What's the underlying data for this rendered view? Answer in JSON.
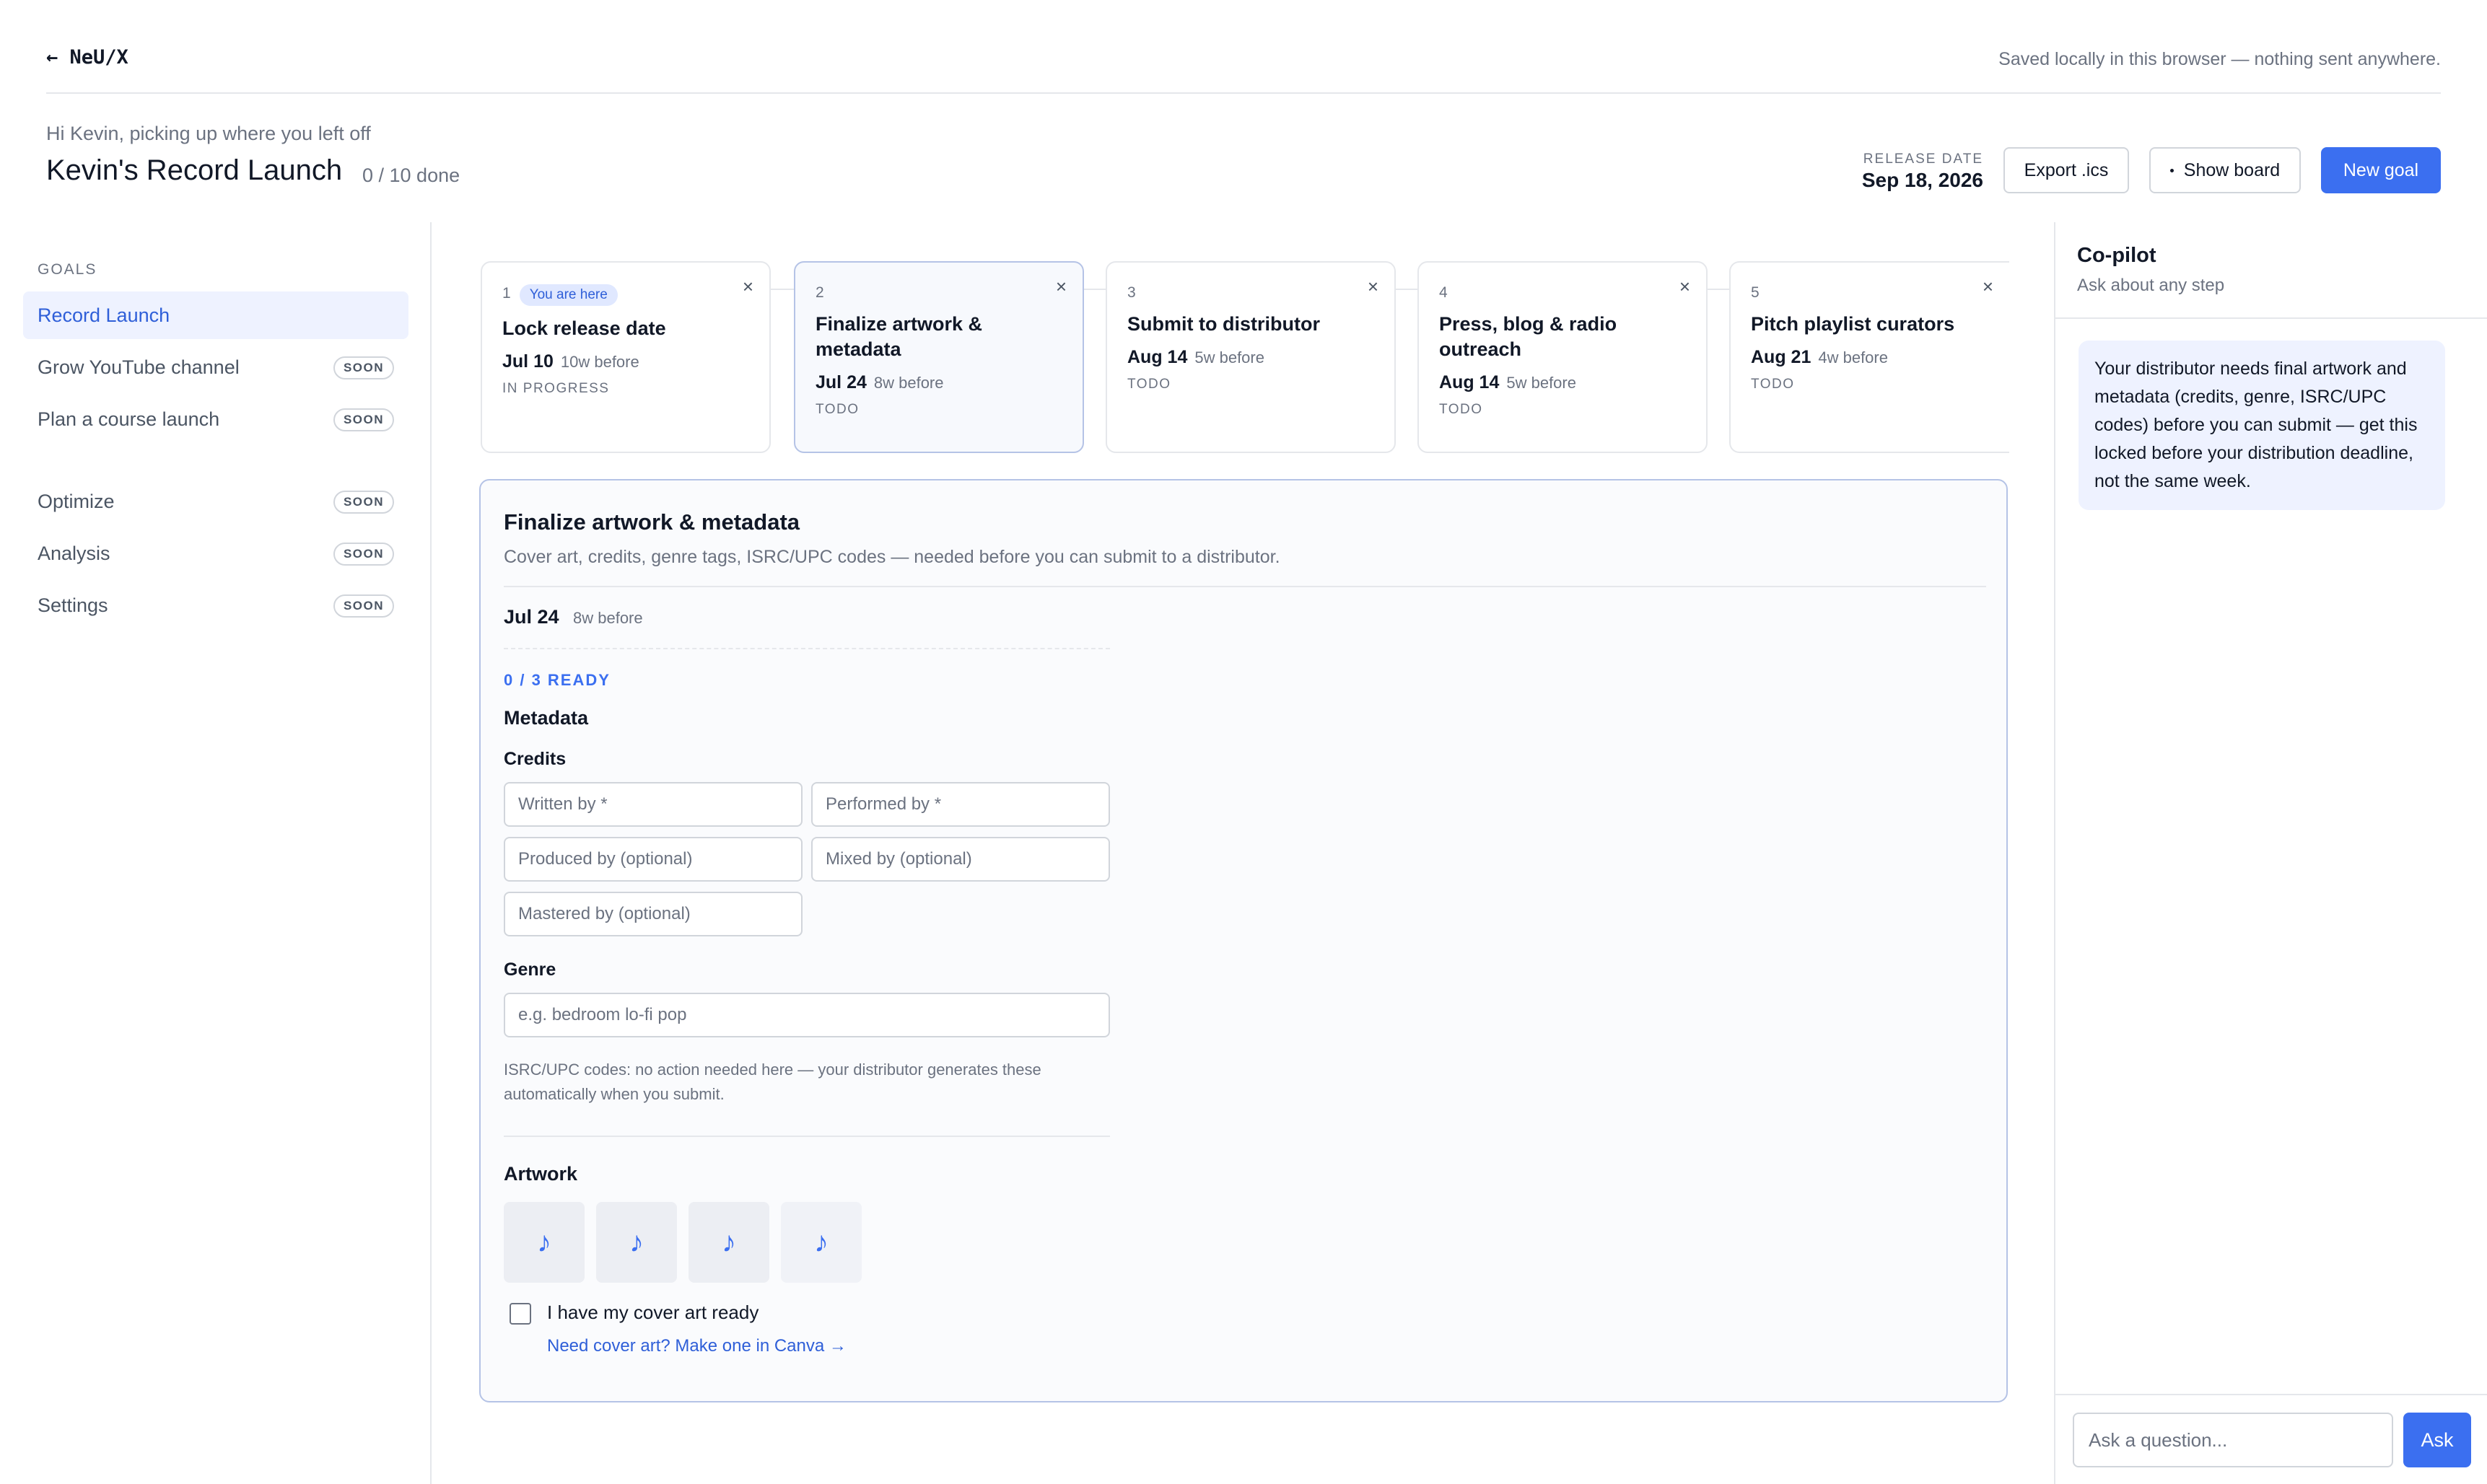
{
  "topbar": {
    "brand": "← NeU/X",
    "saved_note": "Saved locally in this browser — nothing sent anywhere."
  },
  "header": {
    "greeting": "Hi Kevin, picking up where you left off",
    "title": "Kevin's Record Launch",
    "progress": "0 / 10 done",
    "release_label": "RELEASE DATE",
    "release_date": "Sep 18, 2026",
    "export_label": "Export .ics",
    "board_label": "Show board",
    "new_goal_label": "New goal"
  },
  "sidebar": {
    "heading": "GOALS",
    "items": [
      {
        "label": "Record Launch",
        "badge": ""
      },
      {
        "label": "Grow YouTube channel",
        "badge": "SOON"
      },
      {
        "label": "Plan a course launch",
        "badge": "SOON"
      },
      {
        "label": "Optimize",
        "badge": "SOON"
      },
      {
        "label": "Analysis",
        "badge": "SOON"
      },
      {
        "label": "Settings",
        "badge": "SOON"
      }
    ]
  },
  "steps": [
    {
      "num": "1",
      "badge": "You are here",
      "title": "Lock release date",
      "date": "Jul 10",
      "rel": "10w before",
      "status": "IN PROGRESS",
      "close": "×"
    },
    {
      "num": "2",
      "badge": "",
      "title": "Finalize artwork & metadata",
      "date": "Jul 24",
      "rel": "8w before",
      "status": "TODO",
      "close": "×"
    },
    {
      "num": "3",
      "badge": "",
      "title": "Submit to distributor",
      "date": "Aug 14",
      "rel": "5w before",
      "status": "TODO",
      "close": "×"
    },
    {
      "num": "4",
      "badge": "",
      "title": "Press, blog & radio outreach",
      "date": "Aug 14",
      "rel": "5w before",
      "status": "TODO",
      "close": "×"
    },
    {
      "num": "5",
      "badge": "",
      "title": "Pitch playlist curators",
      "date": "Aug 21",
      "rel": "4w before",
      "status": "TODO",
      "close": "×"
    }
  ],
  "detail": {
    "title": "Finalize artwork & metadata",
    "description": "Cover art, credits, genre tags, ISRC/UPC codes — needed before you can submit to a distributor.",
    "date": "Jul 24",
    "rel": "8w before",
    "ready": "0 / 3 READY",
    "metadata_heading": "Metadata",
    "credits_label": "Credits",
    "credits": {
      "written_by": "Written by *",
      "performed_by": "Performed by *",
      "produced_by": "Produced by (optional)",
      "mixed_by": "Mixed by (optional)",
      "mastered_by": "Mastered by (optional)"
    },
    "genre_label": "Genre",
    "genre_placeholder": "e.g. bedroom lo-fi pop",
    "isrc_hint": "ISRC/UPC codes: no action needed here — your distributor generates these automatically when you submit.",
    "artwork_heading": "Artwork",
    "artwork_tiles": [
      "♪",
      "♪",
      "♪",
      "♪"
    ],
    "cover_checkbox_label": "I have my cover art ready",
    "canva_link": "Need cover art? Make one in Canva →"
  },
  "copilot": {
    "title": "Co-pilot",
    "subtitle": "Ask about any step",
    "message": "Your distributor needs final artwork and metadata (credits, genre, ISRC/UPC codes) before you can submit — get this locked before your distribution deadline, not the same week.",
    "input_placeholder": "Ask a question...",
    "ask_label": "Ask"
  },
  "colors": {
    "accent": "#3b6ff0",
    "accent_soft": "#eef2ff",
    "border": "#e5e7eb",
    "muted_text": "#6b7280"
  }
}
